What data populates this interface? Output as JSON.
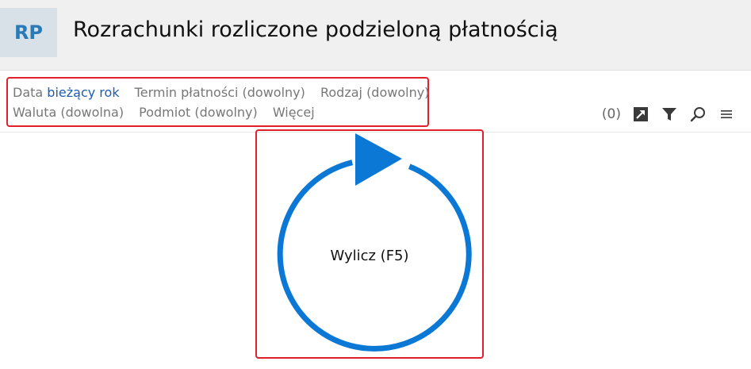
{
  "app": {
    "badge": "RP",
    "title": "Rozrachunki rozliczone podzieloną płatnością"
  },
  "filters": {
    "row1": [
      {
        "label": "Data",
        "value": "bieżący rok"
      },
      {
        "label": "Termin płatności",
        "value": "(dowolny)"
      },
      {
        "label": "Rodzaj",
        "value": "(dowolny)"
      }
    ],
    "row2": [
      {
        "label": "Waluta",
        "value": "(dowolna)"
      },
      {
        "label": "Podmiot",
        "value": "(dowolny)"
      },
      {
        "label": "Więcej",
        "value": ""
      }
    ]
  },
  "toolbar": {
    "count": "(0)",
    "icons": [
      "export-icon",
      "filter-icon",
      "search-icon",
      "menu-icon"
    ]
  },
  "calculate": {
    "label": "Wylicz (F5)",
    "color": "#0a78d4"
  },
  "colors": {
    "accent": "#0a78d4",
    "active_filter": "#1e5db0",
    "highlight": "#e0202a"
  }
}
